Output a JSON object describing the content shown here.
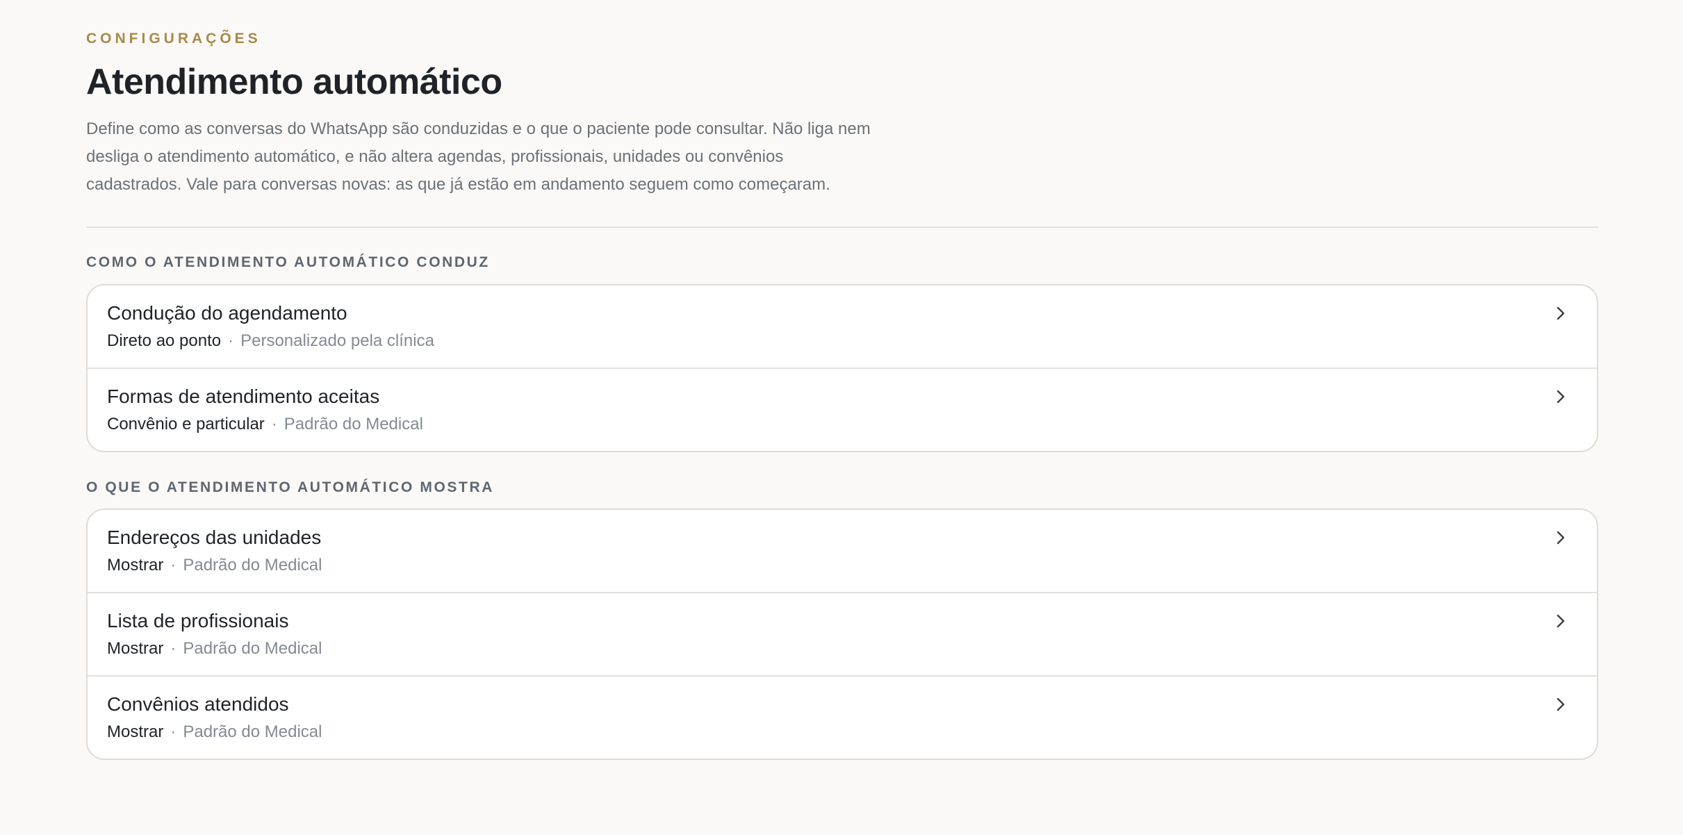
{
  "header": {
    "eyebrow": "CONFIGURAÇÕES",
    "title": "Atendimento automático",
    "description": "Define como as conversas do WhatsApp são conduzidas e o que o paciente pode consultar. Não liga nem desliga o atendimento automático, e não altera agendas, profissionais, unidades ou convênios cadastrados. Vale para conversas novas: as que já estão em andamento seguem como começaram."
  },
  "sections": [
    {
      "heading": "COMO O ATENDIMENTO AUTOMÁTICO CONDUZ",
      "rows": [
        {
          "title": "Condução do agendamento",
          "value": "Direto ao ponto",
          "separator": "·",
          "source": "Personalizado pela clínica",
          "icon": "chevron-right-icon"
        },
        {
          "title": "Formas de atendimento aceitas",
          "value": "Convênio e particular",
          "separator": "·",
          "source": "Padrão do Medical",
          "icon": "chevron-right-icon"
        }
      ]
    },
    {
      "heading": "O QUE O ATENDIMENTO AUTOMÁTICO MOSTRA",
      "rows": [
        {
          "title": "Endereços das unidades",
          "value": "Mostrar",
          "separator": "·",
          "source": "Padrão do Medical",
          "icon": "chevron-right-icon"
        },
        {
          "title": "Lista de profissionais",
          "value": "Mostrar",
          "separator": "·",
          "source": "Padrão do Medical",
          "icon": "chevron-right-icon"
        },
        {
          "title": "Convênios atendidos",
          "value": "Mostrar",
          "separator": "·",
          "source": "Padrão do Medical",
          "icon": "chevron-right-icon"
        }
      ]
    }
  ],
  "colors": {
    "background": "#faf9f7",
    "accent": "#a88a4a",
    "text": "#1f2328",
    "muted": "#6b7178",
    "border": "#dedcd8"
  }
}
